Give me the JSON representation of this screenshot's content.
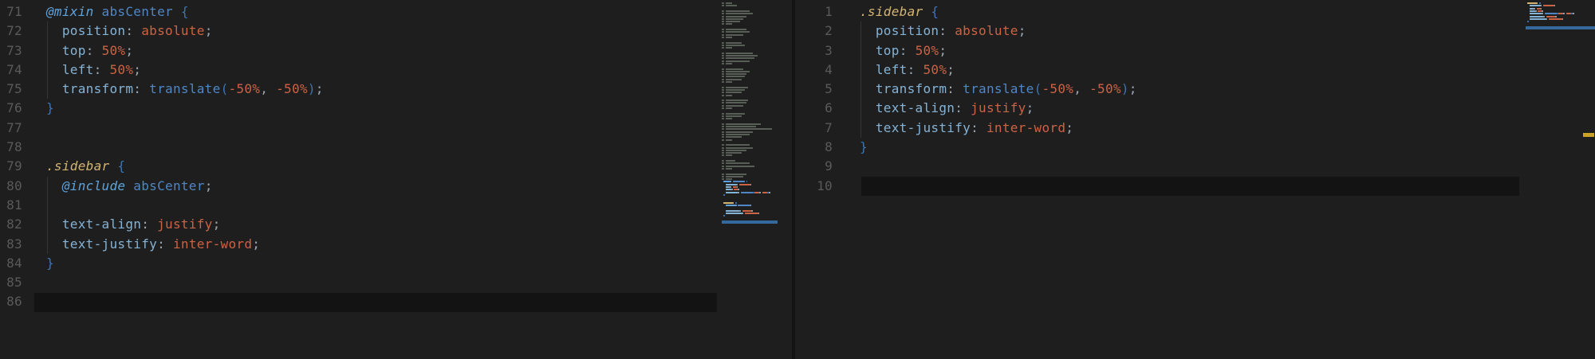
{
  "app": {
    "description": "dark code editor, two panes: SCSS source and compiled CSS"
  },
  "colors": {
    "background": "#1E1E1E",
    "current_line": "#131313",
    "divider": "#141414",
    "line_number": "#5A5A5A",
    "indent_guide": "#343434",
    "plain": "#C8C8C8",
    "keyword_at": "#5FA3DC",
    "function_name": "#4F86C6",
    "brace": "#3E74B2",
    "property": "#85B3D6",
    "punctuation": "#9BA7B0",
    "value": "#CB6345",
    "selector": "#D4B472",
    "minimap_comment": "#575F57",
    "minimap_cursor_bar": "#35689C",
    "overview_marker": "#C9A227"
  },
  "left_editor": {
    "language": "scss",
    "first_line": 71,
    "current_line": 86,
    "lines": [
      {
        "n": 71,
        "tokens": [
          [
            "kw",
            "@mixin"
          ],
          [
            "plain",
            " "
          ],
          [
            "fn",
            "absCenter"
          ],
          [
            "plain",
            " "
          ],
          [
            "brace",
            "{"
          ]
        ]
      },
      {
        "n": 72,
        "guide": true,
        "tokens": [
          [
            "plain",
            "  "
          ],
          [
            "prop",
            "position"
          ],
          [
            "punct",
            ":"
          ],
          [
            "plain",
            " "
          ],
          [
            "val",
            "absolute"
          ],
          [
            "punct",
            ";"
          ]
        ]
      },
      {
        "n": 73,
        "guide": true,
        "tokens": [
          [
            "plain",
            "  "
          ],
          [
            "prop",
            "top"
          ],
          [
            "punct",
            ":"
          ],
          [
            "plain",
            " "
          ],
          [
            "val",
            "50%"
          ],
          [
            "punct",
            ";"
          ]
        ]
      },
      {
        "n": 74,
        "guide": true,
        "tokens": [
          [
            "plain",
            "  "
          ],
          [
            "prop",
            "left"
          ],
          [
            "punct",
            ":"
          ],
          [
            "plain",
            " "
          ],
          [
            "val",
            "50%"
          ],
          [
            "punct",
            ";"
          ]
        ]
      },
      {
        "n": 75,
        "guide": true,
        "tokens": [
          [
            "plain",
            "  "
          ],
          [
            "prop",
            "transform"
          ],
          [
            "punct",
            ":"
          ],
          [
            "plain",
            " "
          ],
          [
            "fn",
            "translate"
          ],
          [
            "brace",
            "("
          ],
          [
            "val",
            "-50%"
          ],
          [
            "punct",
            ","
          ],
          [
            "plain",
            " "
          ],
          [
            "val",
            "-50%"
          ],
          [
            "brace",
            ")"
          ],
          [
            "punct",
            ";"
          ]
        ]
      },
      {
        "n": 76,
        "tokens": [
          [
            "brace",
            "}"
          ]
        ]
      },
      {
        "n": 77,
        "tokens": []
      },
      {
        "n": 78,
        "tokens": []
      },
      {
        "n": 79,
        "tokens": [
          [
            "sel",
            ".sidebar"
          ],
          [
            "plain",
            " "
          ],
          [
            "brace",
            "{"
          ]
        ]
      },
      {
        "n": 80,
        "guide": true,
        "tokens": [
          [
            "plain",
            "  "
          ],
          [
            "kw",
            "@include"
          ],
          [
            "plain",
            " "
          ],
          [
            "fn",
            "absCenter"
          ],
          [
            "punct",
            ";"
          ]
        ]
      },
      {
        "n": 81,
        "guide": true,
        "tokens": []
      },
      {
        "n": 82,
        "guide": true,
        "tokens": [
          [
            "plain",
            "  "
          ],
          [
            "prop",
            "text-align"
          ],
          [
            "punct",
            ":"
          ],
          [
            "plain",
            " "
          ],
          [
            "val",
            "justify"
          ],
          [
            "punct",
            ";"
          ]
        ]
      },
      {
        "n": 83,
        "guide": true,
        "tokens": [
          [
            "plain",
            "  "
          ],
          [
            "prop",
            "text-justify"
          ],
          [
            "punct",
            ":"
          ],
          [
            "plain",
            " "
          ],
          [
            "val",
            "inter-word"
          ],
          [
            "punct",
            ";"
          ]
        ]
      },
      {
        "n": 84,
        "tokens": [
          [
            "brace",
            "}"
          ]
        ]
      },
      {
        "n": 85,
        "tokens": []
      },
      {
        "n": 86,
        "tokens": []
      }
    ]
  },
  "right_editor": {
    "language": "css",
    "first_line": 1,
    "current_line": 10,
    "lines": [
      {
        "n": 1,
        "tokens": [
          [
            "sel",
            ".sidebar"
          ],
          [
            "plain",
            " "
          ],
          [
            "brace",
            "{"
          ]
        ]
      },
      {
        "n": 2,
        "guide": true,
        "tokens": [
          [
            "plain",
            "  "
          ],
          [
            "prop",
            "position"
          ],
          [
            "punct",
            ":"
          ],
          [
            "plain",
            " "
          ],
          [
            "val",
            "absolute"
          ],
          [
            "punct",
            ";"
          ]
        ]
      },
      {
        "n": 3,
        "guide": true,
        "tokens": [
          [
            "plain",
            "  "
          ],
          [
            "prop",
            "top"
          ],
          [
            "punct",
            ":"
          ],
          [
            "plain",
            " "
          ],
          [
            "val",
            "50%"
          ],
          [
            "punct",
            ";"
          ]
        ]
      },
      {
        "n": 4,
        "guide": true,
        "tokens": [
          [
            "plain",
            "  "
          ],
          [
            "prop",
            "left"
          ],
          [
            "punct",
            ":"
          ],
          [
            "plain",
            " "
          ],
          [
            "val",
            "50%"
          ],
          [
            "punct",
            ";"
          ]
        ]
      },
      {
        "n": 5,
        "guide": true,
        "tokens": [
          [
            "plain",
            "  "
          ],
          [
            "prop",
            "transform"
          ],
          [
            "punct",
            ":"
          ],
          [
            "plain",
            " "
          ],
          [
            "fn",
            "translate"
          ],
          [
            "brace",
            "("
          ],
          [
            "val",
            "-50%"
          ],
          [
            "punct",
            ","
          ],
          [
            "plain",
            " "
          ],
          [
            "val",
            "-50%"
          ],
          [
            "brace",
            ")"
          ],
          [
            "punct",
            ";"
          ]
        ]
      },
      {
        "n": 6,
        "guide": true,
        "tokens": [
          [
            "plain",
            "  "
          ],
          [
            "prop",
            "text-align"
          ],
          [
            "punct",
            ":"
          ],
          [
            "plain",
            " "
          ],
          [
            "val",
            "justify"
          ],
          [
            "punct",
            ";"
          ]
        ]
      },
      {
        "n": 7,
        "guide": true,
        "tokens": [
          [
            "plain",
            "  "
          ],
          [
            "prop",
            "text-justify"
          ],
          [
            "punct",
            ":"
          ],
          [
            "plain",
            " "
          ],
          [
            "val",
            "inter-word"
          ],
          [
            "punct",
            ";"
          ]
        ]
      },
      {
        "n": 8,
        "tokens": [
          [
            "brace",
            "}"
          ]
        ]
      },
      {
        "n": 9,
        "tokens": []
      },
      {
        "n": 10,
        "tokens": []
      }
    ]
  },
  "left_minimap": {
    "code_start_row": 68,
    "cursor_bar_width": 70,
    "comment_blocks": [
      [
        8,
        14
      ],
      [
        30,
        34,
        26,
        22,
        18,
        8
      ],
      [
        26,
        30,
        22,
        8
      ],
      [
        20,
        24,
        8
      ],
      [
        34,
        40,
        36,
        30,
        8
      ],
      [
        22,
        30,
        26,
        24,
        20,
        8
      ],
      [
        28,
        24,
        20,
        8
      ],
      [
        28,
        26,
        22,
        8
      ],
      [
        24,
        20,
        8
      ],
      [
        44,
        38,
        58,
        34,
        30,
        20,
        8
      ],
      [
        30,
        34,
        26,
        20,
        8
      ],
      [
        12,
        30,
        36,
        8
      ],
      [
        26,
        22,
        8
      ]
    ]
  },
  "right_minimap": {
    "code_start_row": 0,
    "cursor_bar_width": 89,
    "comment_blocks": []
  },
  "overview_ruler": {
    "marker": "warning"
  }
}
